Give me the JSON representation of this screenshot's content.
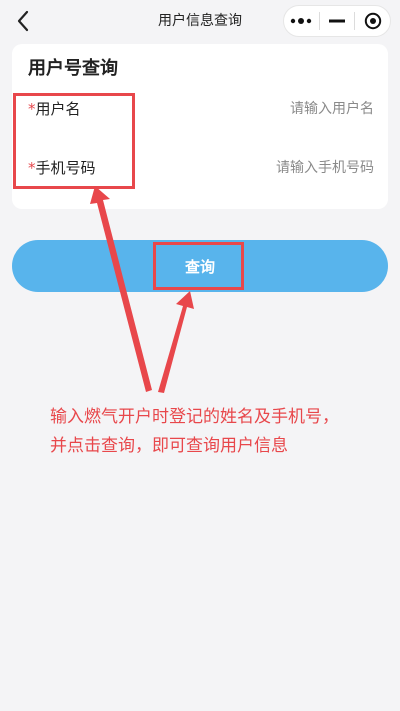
{
  "navbar": {
    "title": "用户信息查询",
    "back_icon": "chevron-left-icon",
    "capsule_icons": [
      "more-dots-icon",
      "minimize-icon",
      "close-circle-icon"
    ]
  },
  "card": {
    "title": "用户号查询",
    "fields": [
      {
        "required_mark": "*",
        "label": "用户名",
        "value": "",
        "placeholder": "请输入用户名"
      },
      {
        "required_mark": "*",
        "label": "手机号码",
        "value": "",
        "placeholder": "请输入手机号码"
      }
    ]
  },
  "query_button": {
    "label": "查询"
  },
  "annotation": {
    "line1": "输入燃气开户时登记的姓名及手机号，",
    "line2": "并点击查询，即可查询用户信息",
    "color": "#e8474b"
  },
  "colors": {
    "background": "#f4f4f6",
    "button": "#58b4ec",
    "required": "#e5484d",
    "annotation": "#e8474b"
  }
}
